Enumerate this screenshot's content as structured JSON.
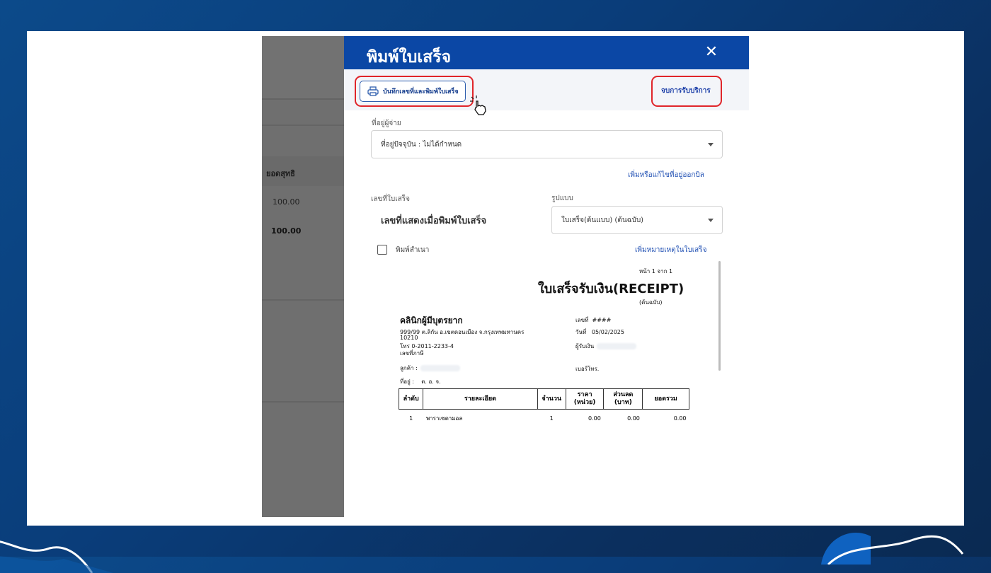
{
  "background_app": {
    "column_header": "ยอดสุทธิ",
    "row_value": "100.00",
    "total_value": "100.00"
  },
  "modal": {
    "title": "พิมพ์ใบเสร็จ",
    "close_icon": "close-icon",
    "toolbar": {
      "print_button_label": "บันทึกเลขที่และพิมพ์ใบเสร็จ",
      "print_icon": "printer-icon",
      "end_service_label": "จบการรับบริการ"
    },
    "seller_address": {
      "label": "ที่อยู่ผู้จ่าย",
      "selected": "ที่อยู่ปัจจุบัน : ไม่ได้กำหนด"
    },
    "edit_address_link": "เพิ่มหรือแก้ไขที่อยู่ออกบิล",
    "invoice_number": {
      "label": "เลขที่ใบเสร็จ",
      "value": "เลขที่แสดงเมื่อพิมพ์ใบเสร็จ"
    },
    "format": {
      "label": "รูปแบบ",
      "selected": "ใบเสร็จ(ต้นแบบ) (ต้นฉบับ)"
    },
    "print_copy": {
      "label": "พิมพ์สำเนา",
      "checked": false
    },
    "add_note_link": "เพิ่มหมายเหตุในใบเสร็จ"
  },
  "receipt": {
    "page_info": "หน้า 1 จาก 1",
    "title": "ใบเสร็จรับเงิน(RECEIPT)",
    "copy_type": "(ต้นฉบับ)",
    "clinic_name": "คลินิกผู้มีบุตรยาก",
    "address_line1": "999/99  ต.ลิกัน อ.เขตดอนเมือง จ.กรุงเทพมหานคร",
    "address_line2": "10210",
    "phone": "โทร 0-2011-2233-4",
    "tax_id_label": "เลขที่ภาษี",
    "number_label": "เลขที่",
    "number_value": "####",
    "date_label": "วันที่",
    "date_value": "05/02/2025",
    "receiver_label": "ผู้รับเงิน",
    "customer_label": "ลูกค้า :",
    "phone_label": "เบอร์โทร.",
    "address_label": "ที่อยู่ :",
    "address_value": "ต. อ. จ.",
    "table": {
      "headers": [
        "ลำดับ",
        "รายละเอียด",
        "จำนวน",
        "ราคา (หน่วย)",
        "ส่วนลด (บาท)",
        "ยอดรวม"
      ],
      "rows": [
        [
          "1",
          "พาราเซตามอล",
          "1",
          "0.00",
          "0.00",
          "0.00"
        ]
      ]
    }
  }
}
